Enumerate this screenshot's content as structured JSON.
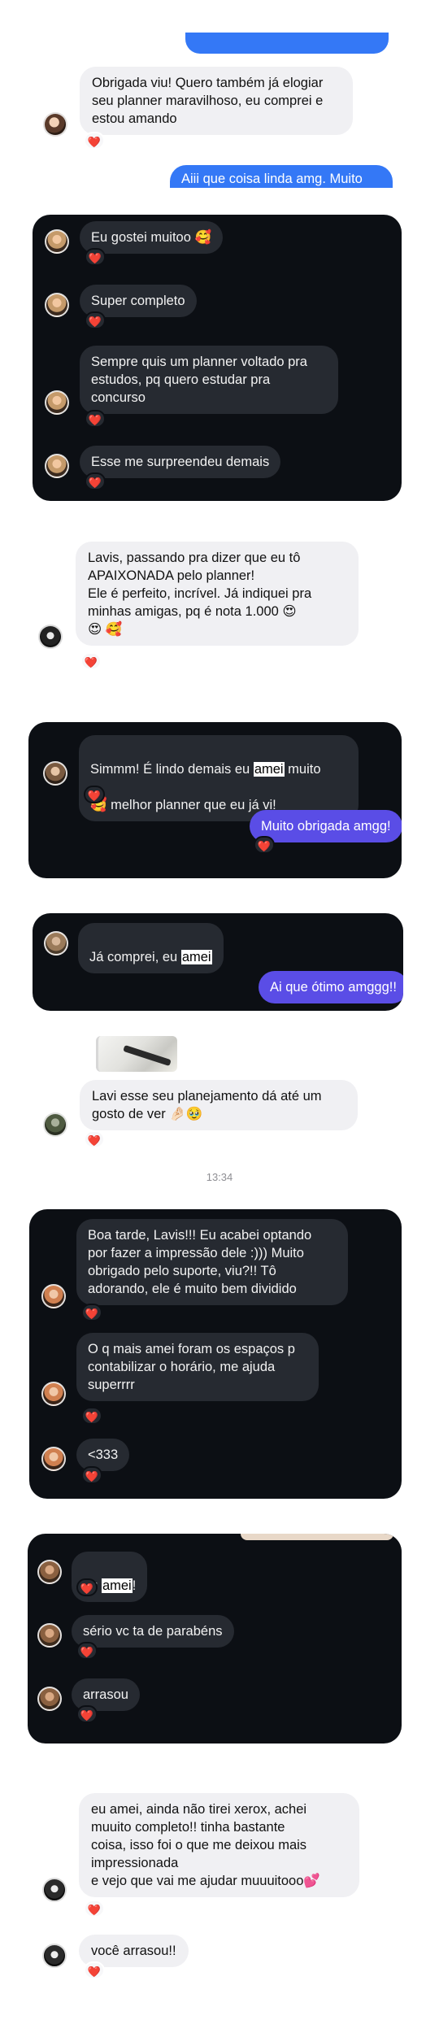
{
  "top": {
    "received_msg": "Obrigada viu! Quero também já elogiar seu planner maravilhoso, eu comprei e estou amando",
    "sent_msg": "Aiii que coisa linda amg. Muito"
  },
  "panel1": {
    "messages": [
      "Eu gostei muitoo 🥰",
      "Super completo",
      "Sempre quis um planner voltado pra\nestudos, pq quero estudar pra\nconcurso",
      "Esse me surpreendeu demais"
    ]
  },
  "mid": {
    "received_msg": "Lavis, passando pra dizer que eu tô\nAPAIXONADA pelo planner!\nEle é perfeito, incrível. Já indiquei pra\nminhas amigas, pq é nota 1.000 😍\n😍 🥰"
  },
  "panel2": {
    "line1_pre": "Simmm! É lindo demais eu ",
    "line1_hl": "amei",
    "line1_post": " muito",
    "line2": "🥰 melhor planner que eu já vi!",
    "sent_msg": "Muito obrigada amgg!"
  },
  "panel3": {
    "received_pre": "Já comprei, eu ",
    "received_hl": "amei",
    "sent_msg": "Ai que ótimo amggg!!"
  },
  "lavi": {
    "received_msg": "Lavi esse seu planejamento dá até um\ngosto de ver 🤌🏻🥹"
  },
  "timestamp": "13:34",
  "panel4": {
    "messages": [
      "Boa tarde, Lavis!!! Eu acabei optando\npor fazer a impressão dele :))) Muito\nobrigado pelo suporte, viu?!! Tô\nadorando, ele é muito bem dividido",
      "O q mais amei foram os espaços p\ncontabilizar o horário, me ajuda\nsuperrrr",
      "<333"
    ]
  },
  "panel5": {
    "msg1_pre": "eu ",
    "msg1_hl": "amei",
    "msg1_post": "!",
    "msg2": "sério vc ta de parabéns",
    "msg3": "arrasou"
  },
  "bottom": {
    "received_msg": "eu amei, ainda não tirei xerox, achei\nmuuito completo!! tinha bastante\ncoisa, isso foi o que me deixou mais\nimpressionada\ne vejo que vai me ajudar muuuitooo💕",
    "received_msg2": "você arrasou!!"
  },
  "reaction_emoji": "❤️",
  "colors": {
    "sent_blue": "#3478f6",
    "sent_purple": "#5a4de6",
    "dark_panel": "#0c0f14",
    "dark_bubble": "#262a31",
    "light_bubble": "#f0f0f3",
    "reaction": "#e0245e"
  }
}
